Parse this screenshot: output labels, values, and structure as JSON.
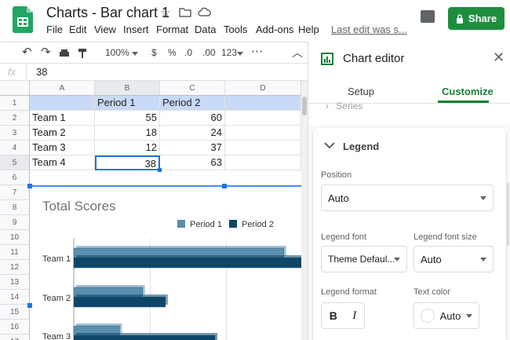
{
  "header": {
    "doc_title": "Charts - Bar chart 1",
    "menu": [
      "File",
      "Edit",
      "View",
      "Insert",
      "Format",
      "Data",
      "Tools",
      "Add-ons",
      "Help"
    ],
    "last_edit": "Last edit was s...",
    "share_label": "Share"
  },
  "toolbar": {
    "zoom": "100%",
    "currency": "$",
    "percent": "%",
    "decrease_decimals": ".0",
    "increase_decimals": ".00",
    "format_more": "123"
  },
  "formula_bar": {
    "fx": "fx",
    "value": "38"
  },
  "sheet": {
    "columns": [
      "A",
      "B",
      "C",
      "D"
    ],
    "rows": [
      "1",
      "2",
      "3",
      "4",
      "5",
      "6",
      "7",
      "8",
      "9",
      "10",
      "11",
      "12",
      "13",
      "14",
      "15",
      "16",
      "17"
    ],
    "header_row": [
      "",
      "Period 1",
      "Period 2",
      ""
    ],
    "data": [
      {
        "team": "Team 1",
        "p1": "55",
        "p2": "60"
      },
      {
        "team": "Team 2",
        "p1": "18",
        "p2": "24"
      },
      {
        "team": "Team 3",
        "p1": "12",
        "p2": "37"
      },
      {
        "team": "Team 4",
        "p1": "38",
        "p2": "63"
      }
    ]
  },
  "chart_data": {
    "type": "bar",
    "title": "Total Scores",
    "categories": [
      "Team 1",
      "Team 2",
      "Team 3"
    ],
    "series": [
      {
        "name": "Period 1",
        "values": [
          55,
          18,
          12
        ],
        "color": "#5b8fae"
      },
      {
        "name": "Period 2",
        "values": [
          60,
          24,
          37
        ],
        "color": "#0e4668"
      }
    ],
    "legend": "top"
  },
  "editor": {
    "title": "Chart editor",
    "tabs": [
      "Setup",
      "Customize"
    ],
    "active_tab": "Customize",
    "series_label": "Series",
    "legend_section": "Legend",
    "position_label": "Position",
    "position_value": "Auto",
    "legend_font_label": "Legend font",
    "legend_font_value": "Theme Defaul...",
    "legend_font_size_label": "Legend font size",
    "legend_font_size_value": "Auto",
    "legend_format_label": "Legend format",
    "bold": "B",
    "italic": "I",
    "text_color_label": "Text color",
    "text_color_value": "Auto",
    "accent": "#188038"
  }
}
